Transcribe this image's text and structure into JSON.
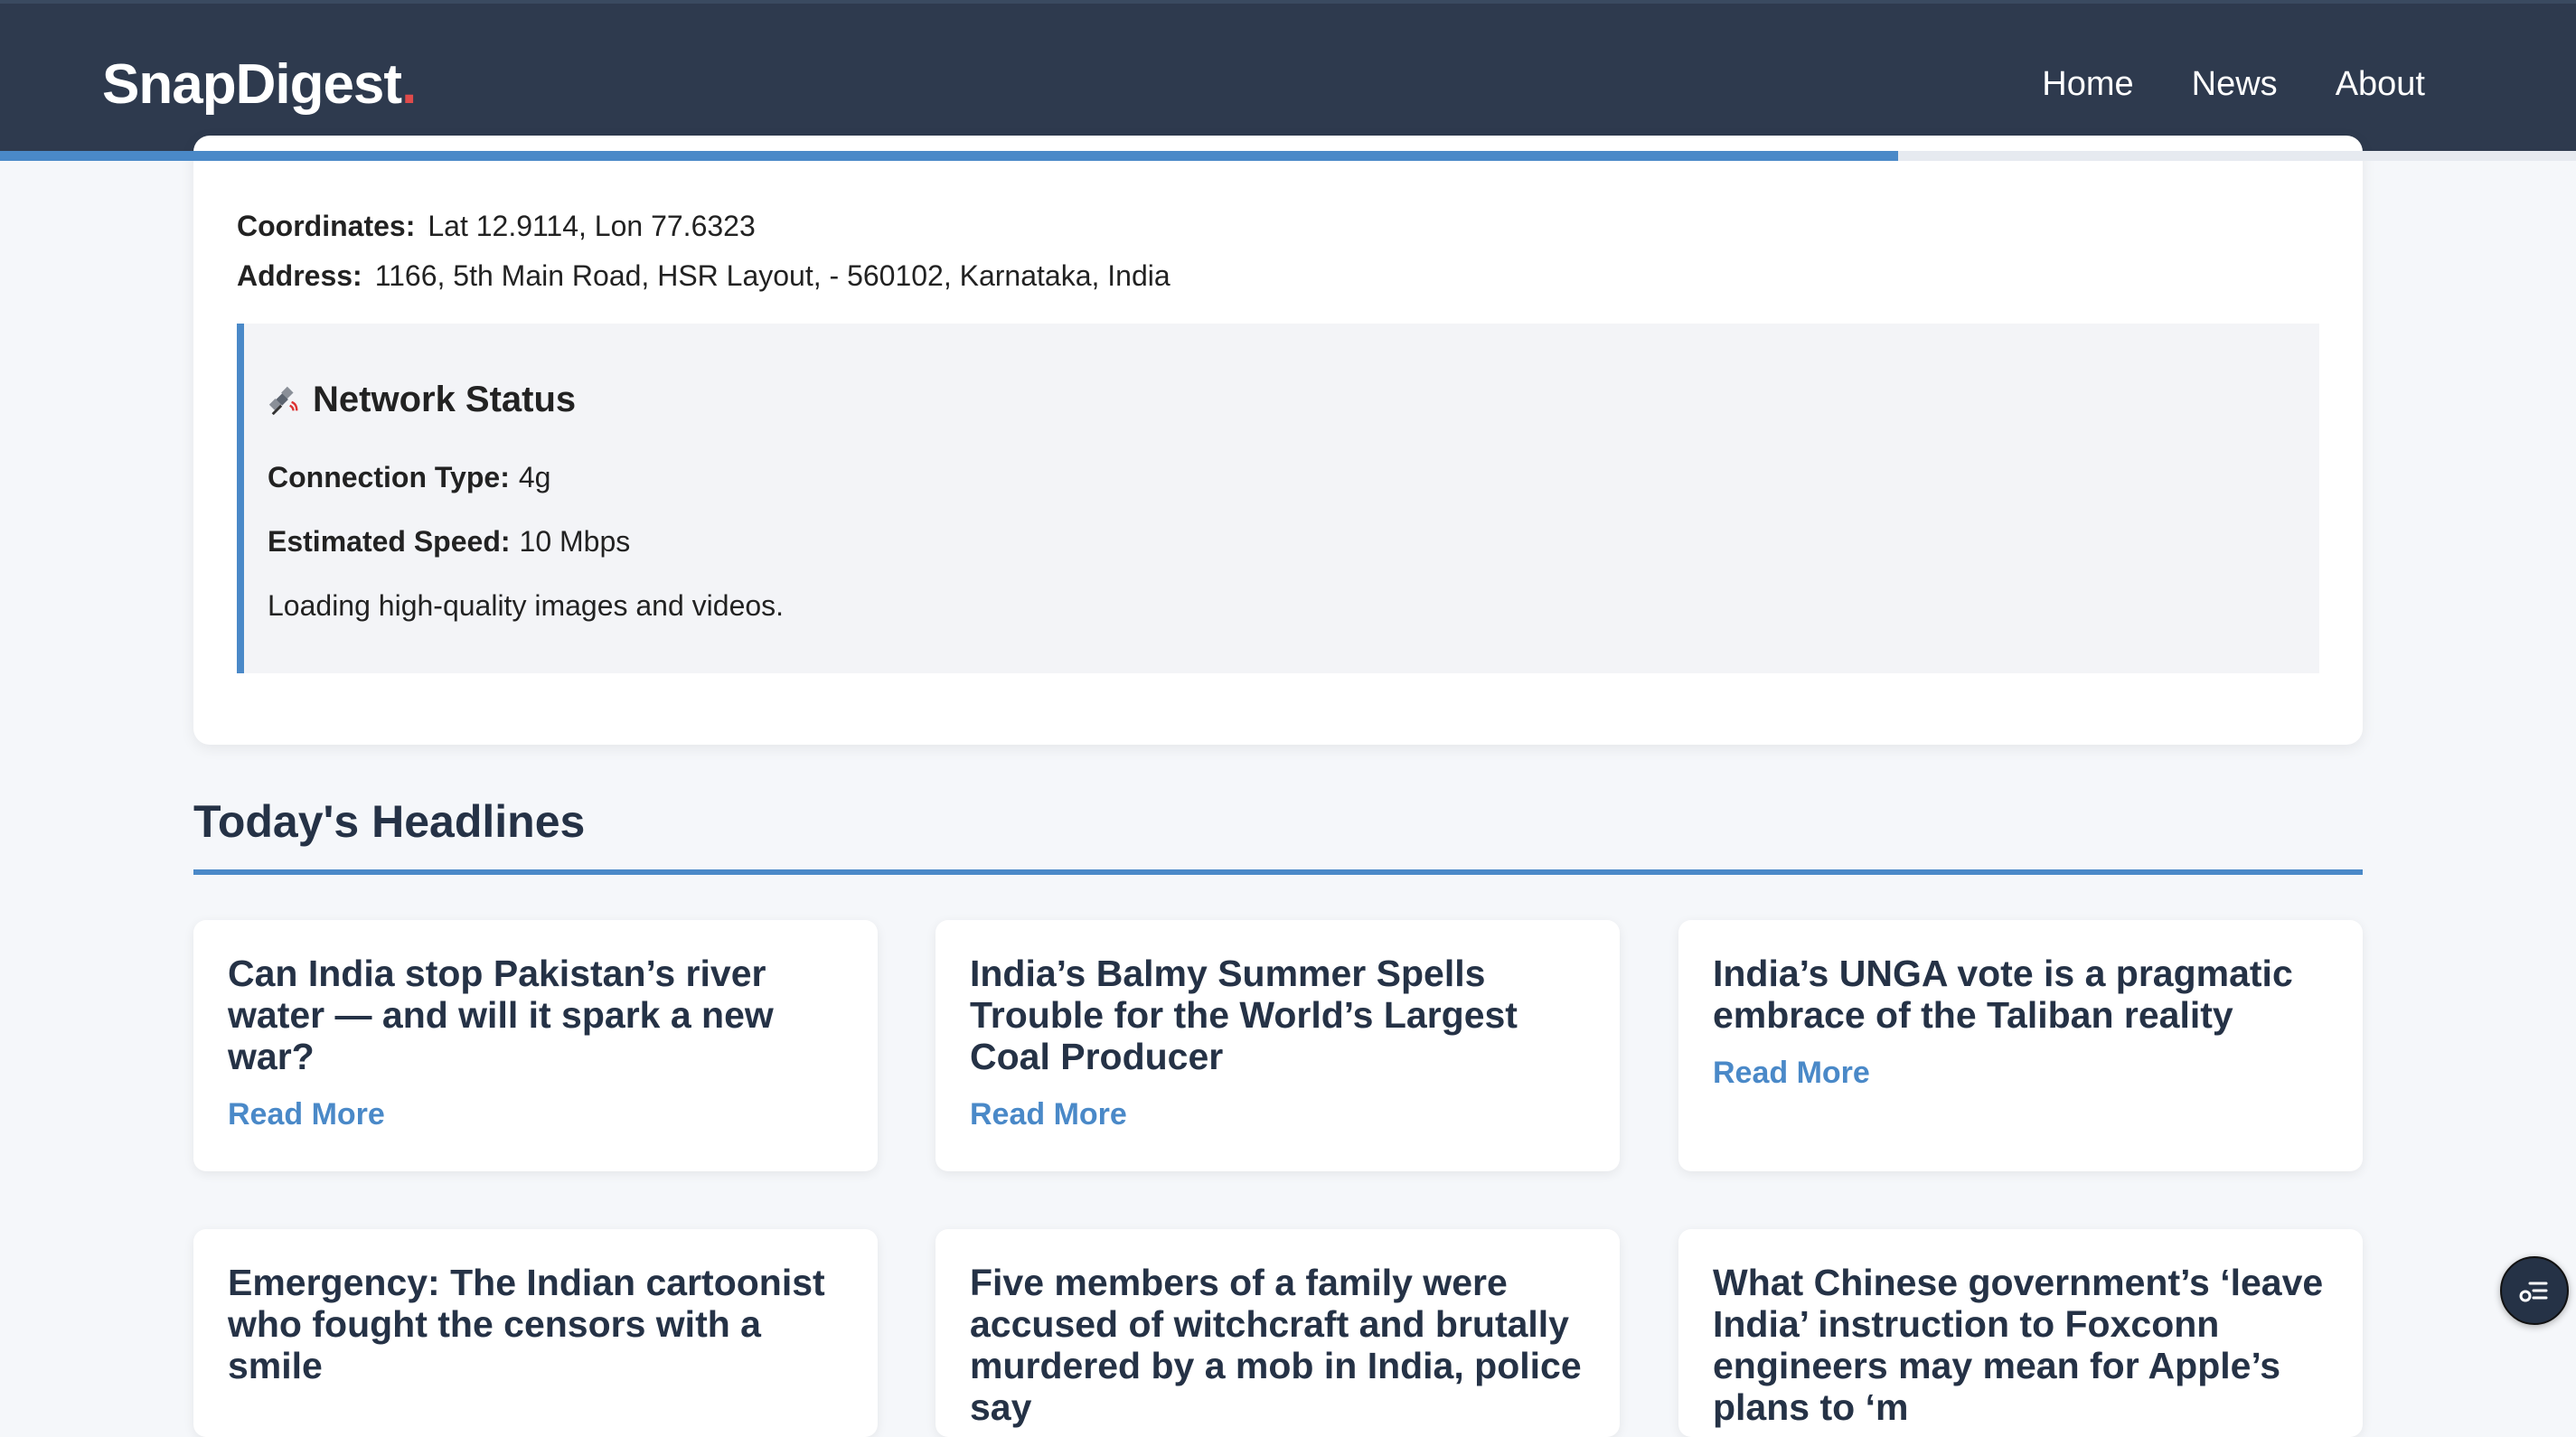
{
  "header": {
    "logo_text": "SnapDigest",
    "logo_dot": ".",
    "nav": [
      {
        "label": "Home"
      },
      {
        "label": "News"
      },
      {
        "label": "About"
      }
    ]
  },
  "scroll_progress": 0.737,
  "location": {
    "coordinates_label": "Coordinates:",
    "coordinates_value": "Lat 12.9114, Lon 77.6323",
    "address_label": "Address:",
    "address_value": "1166, 5th Main Road, HSR Layout, - 560102, Karnataka, India"
  },
  "network": {
    "icon": "satellite-icon",
    "title": "Network Status",
    "connection_label": "Connection Type:",
    "connection_value": "4g",
    "speed_label": "Estimated Speed:",
    "speed_value": "10 Mbps",
    "message": "Loading high-quality images and videos."
  },
  "headlines": {
    "title": "Today's Headlines",
    "read_more_label": "Read More",
    "items": [
      {
        "title": "Can India stop Pakistan’s river water — and will it spark a new war?",
        "link": "Read More"
      },
      {
        "title": "India’s Balmy Summer Spells Trouble for the World’s Largest Coal Producer",
        "link": "Read More"
      },
      {
        "title": "India’s UNGA vote is a pragmatic embrace of the Taliban reality",
        "link": "Read More"
      },
      {
        "title": "Emergency: The Indian cartoonist who fought the censors with a smile"
      },
      {
        "title": "Five members of a family were accused of witchcraft and brutally murdered by a mob in India, police say"
      },
      {
        "title": "What Chinese government’s ‘leave India’ instruction to Foxconn engineers may mean for Apple’s plans to ‘m"
      }
    ]
  },
  "floating_button": {
    "icon": "list-settings-icon"
  },
  "colors": {
    "header_bg": "#2e3a4e",
    "accent": "#4a89c8",
    "logo_dot": "#e04b4b",
    "page_bg": "#f5f7fa"
  }
}
